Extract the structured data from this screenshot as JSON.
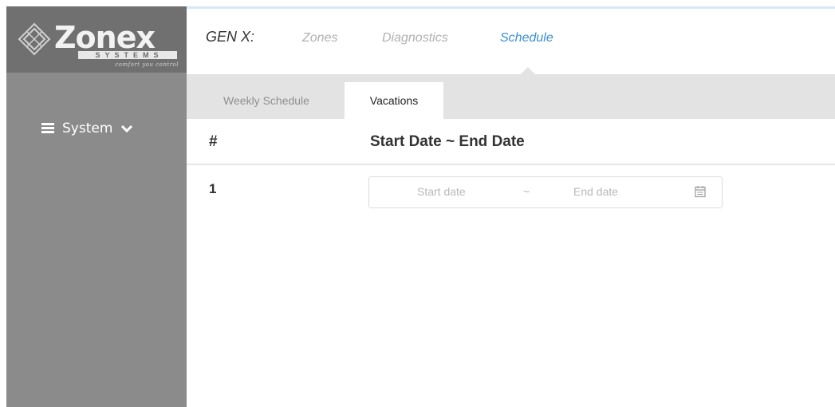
{
  "logo": {
    "brand": "Zonex",
    "systems": "SYSTEMS",
    "tagline": "comfort you control"
  },
  "sidebar": {
    "items": [
      {
        "label": "System",
        "icon": "list-icon",
        "chevron": "chevron-down-icon"
      }
    ]
  },
  "header": {
    "brand": "GEN X:",
    "nav": [
      {
        "label": "Zones",
        "active": false
      },
      {
        "label": "Diagnostics",
        "active": false
      },
      {
        "label": "Schedule",
        "active": true
      }
    ]
  },
  "tabs": [
    {
      "label": "Weekly Schedule",
      "active": false
    },
    {
      "label": "Vacations",
      "active": true
    }
  ],
  "table": {
    "columns": [
      "#",
      "Start Date ~ End Date"
    ],
    "rows": [
      {
        "num": "1",
        "start_placeholder": "Start date",
        "separator": "~",
        "end_placeholder": "End date",
        "icon": "calendar-icon"
      }
    ]
  },
  "colors": {
    "sidebar": "#8b8b8b",
    "logo_bar": "#707070",
    "accent": "#3b8fd0",
    "tab_bar": "#e3e3e3"
  }
}
